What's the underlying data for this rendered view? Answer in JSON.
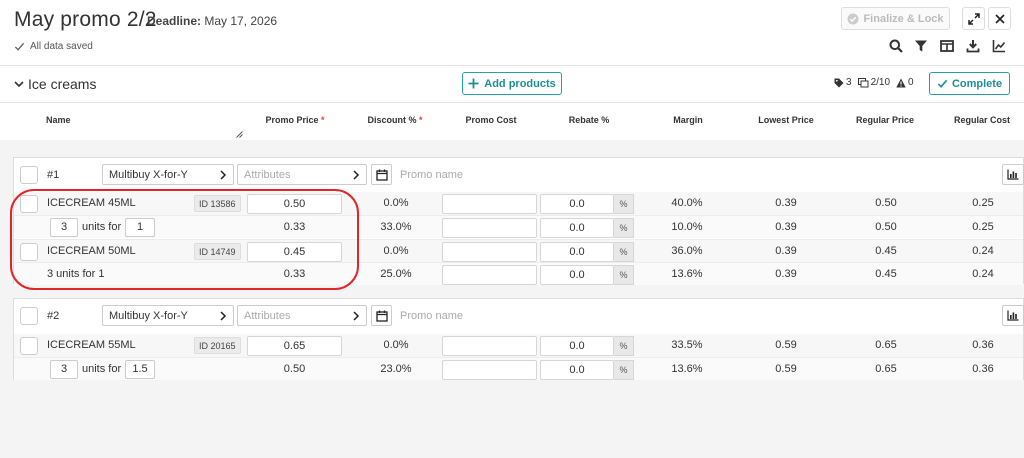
{
  "header": {
    "title": "May promo 2/2",
    "deadline_label": "Deadline:",
    "deadline_value": "May 17, 2026",
    "saved_status": "All data saved",
    "finalize_label": "Finalize & Lock"
  },
  "section": {
    "title": "Ice creams",
    "add_products_label": "Add products",
    "tags_count": "3",
    "copies_count": "2/10",
    "warnings_count": "0",
    "complete_label": "Complete"
  },
  "columns": {
    "name": "Name",
    "promo_price": "Promo Price",
    "discount": "Discount %",
    "promo_cost": "Promo Cost",
    "rebate": "Rebate %",
    "margin": "Margin",
    "lowest_price": "Lowest Price",
    "regular_price": "Regular Price",
    "regular_cost": "Regular Cost",
    "required_mark": "*"
  },
  "promos": [
    {
      "number": "#1",
      "mechanic": "Multibuy X-for-Y",
      "attributes_placeholder": "Attributes",
      "promo_name_placeholder": "Promo name",
      "products": [
        {
          "name": "ICECREAM 45ML",
          "id": "ID 13586",
          "promo_price": "0.50",
          "discount": "0.0%",
          "promo_cost": "",
          "rebate": "0.0",
          "pct": "%",
          "margin": "40.0%",
          "lowest_price": "0.39",
          "regular_price": "0.50",
          "regular_cost": "0.25",
          "sub": {
            "x": "3",
            "units_for": "units for",
            "y": "1",
            "text": "",
            "promo_price": "0.33",
            "discount": "33.0%",
            "promo_cost": "",
            "rebate": "0.0",
            "pct": "%",
            "margin": "10.0%",
            "lowest_price": "0.39",
            "regular_price": "0.50",
            "regular_cost": "0.25"
          }
        },
        {
          "name": "ICECREAM 50ML",
          "id": "ID 14749",
          "promo_price": "0.45",
          "discount": "0.0%",
          "promo_cost": "",
          "rebate": "0.0",
          "pct": "%",
          "margin": "36.0%",
          "lowest_price": "0.39",
          "regular_price": "0.45",
          "regular_cost": "0.24",
          "sub": {
            "text": "3 units for 1",
            "promo_price": "0.33",
            "discount": "25.0%",
            "promo_cost": "",
            "rebate": "0.0",
            "pct": "%",
            "margin": "13.6%",
            "lowest_price": "0.39",
            "regular_price": "0.45",
            "regular_cost": "0.24"
          }
        }
      ]
    },
    {
      "number": "#2",
      "mechanic": "Multibuy X-for-Y",
      "attributes_placeholder": "Attributes",
      "promo_name_placeholder": "Promo name",
      "products": [
        {
          "name": "ICECREAM 55ML",
          "id": "ID 20165",
          "promo_price": "0.65",
          "discount": "0.0%",
          "promo_cost": "",
          "rebate": "0.0",
          "pct": "%",
          "margin": "33.5%",
          "lowest_price": "0.59",
          "regular_price": "0.65",
          "regular_cost": "0.36",
          "sub": {
            "x": "3",
            "units_for": "units for",
            "y": "1.5",
            "text": "",
            "promo_price": "0.50",
            "discount": "23.0%",
            "promo_cost": "",
            "rebate": "0.0",
            "pct": "%",
            "margin": "13.6%",
            "lowest_price": "0.59",
            "regular_price": "0.65",
            "regular_cost": "0.36"
          }
        }
      ]
    }
  ],
  "colors": {
    "accent": "#1d8e96",
    "highlight": "#e0262a",
    "required": "#e53935"
  },
  "icons": [
    "check-icon",
    "expand-icon",
    "close-icon",
    "search-icon",
    "filter-icon",
    "columns-icon",
    "download-icon",
    "chart-icon",
    "chevron-down-icon",
    "plus-icon",
    "tag-icon",
    "copy-icon",
    "warning-icon",
    "calendar-icon",
    "chevron-right-icon",
    "bar-chart-icon",
    "resize-icon"
  ]
}
